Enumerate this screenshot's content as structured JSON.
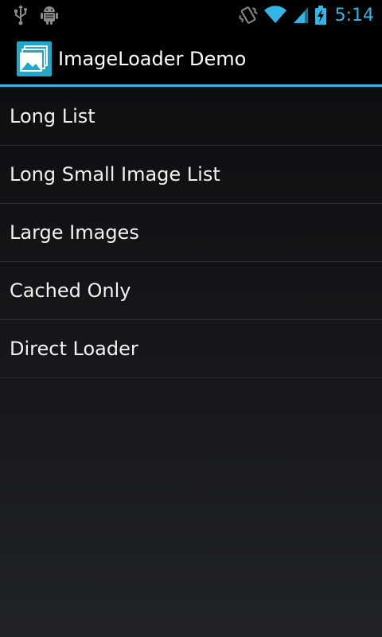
{
  "status_bar": {
    "time": "5:14",
    "time_color": "#33b5e5",
    "left_icons": [
      "usb-icon",
      "android-debug-icon"
    ],
    "right_icons": [
      "vibrate-icon",
      "wifi-icon",
      "signal-icon",
      "battery-charging-icon"
    ]
  },
  "action_bar": {
    "title": "ImageLoader Demo",
    "app_icon": "gallery-icon",
    "accent_color": "#33b5e5"
  },
  "list": {
    "items": [
      {
        "label": "Long List"
      },
      {
        "label": "Long Small Image List"
      },
      {
        "label": "Large Images"
      },
      {
        "label": "Cached Only"
      },
      {
        "label": "Direct Loader"
      }
    ]
  }
}
